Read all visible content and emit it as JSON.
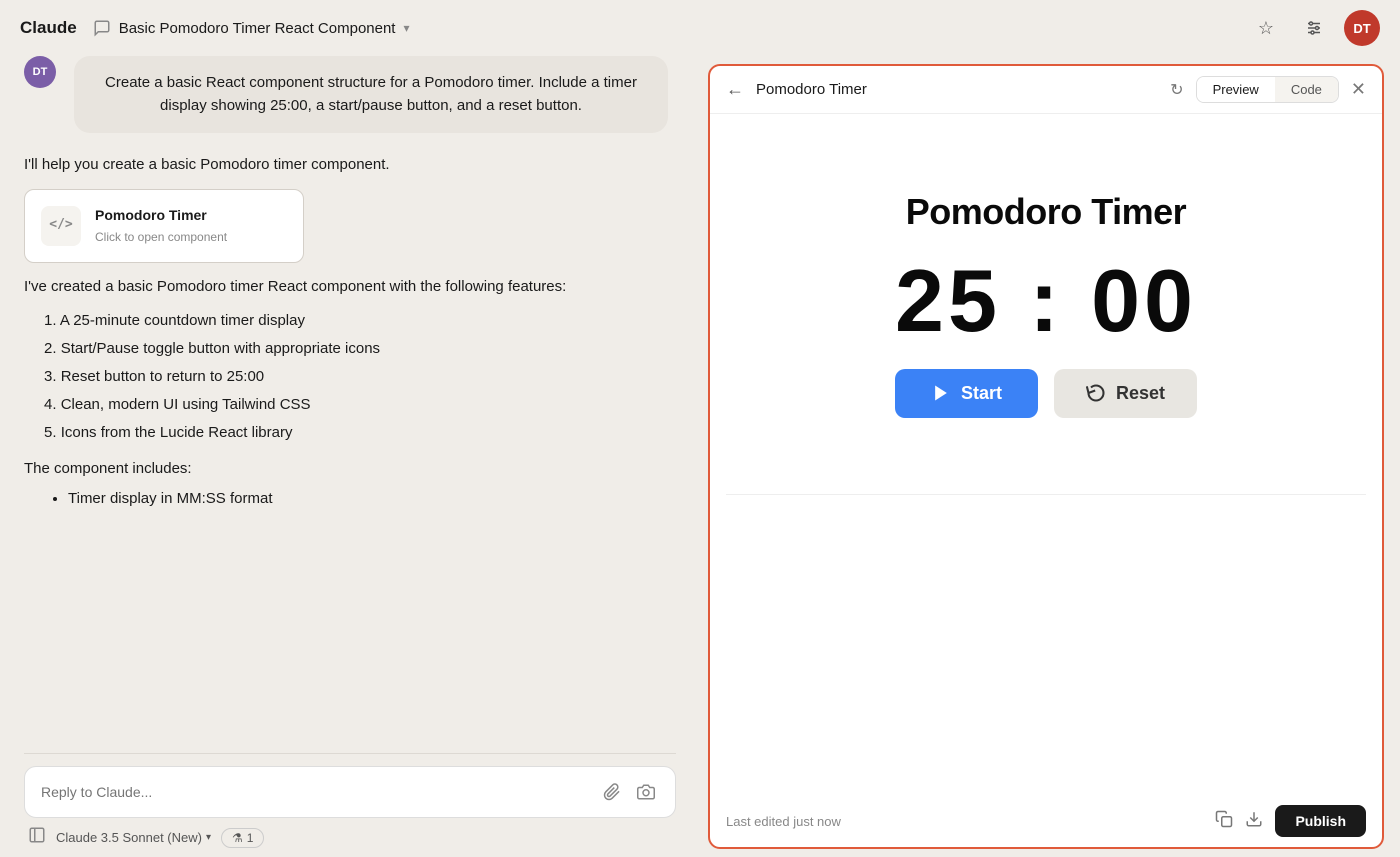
{
  "app": {
    "name": "Claude",
    "convo_title": "Basic Pomodoro Timer React Component",
    "convo_title_chevron": "▾"
  },
  "nav": {
    "star_icon": "☆",
    "settings_icon": "⚙",
    "avatar_initials": "DT"
  },
  "chat": {
    "user_avatar": "DT",
    "user_message": "Create a basic React component structure for a Pomodoro timer. Include a timer display showing 25:00, a start/pause button, and a reset button.",
    "assistant_intro": "I'll help you create a basic Pomodoro timer component.",
    "component_card": {
      "title": "Pomodoro Timer",
      "subtitle": "Click to open component",
      "icon": "</>"
    },
    "assistant_body1": "I've created a basic Pomodoro timer React component with the following features:",
    "features": [
      "A 25-minute countdown timer display",
      "Start/Pause toggle button with appropriate icons",
      "Reset button to return to 25:00",
      "Clean, modern UI using Tailwind CSS",
      "Icons from the Lucide React library"
    ],
    "component_includes_label": "The component includes:",
    "includes": [
      "Timer display in MM:SS format"
    ]
  },
  "input": {
    "placeholder": "Reply to Claude...",
    "model_name": "Claude 3.5 Sonnet (New)",
    "context_count": "1",
    "context_icon": "⚗"
  },
  "preview": {
    "back_icon": "←",
    "refresh_icon": "↻",
    "title": "Pomodoro Timer",
    "tabs": [
      {
        "label": "Preview",
        "active": true
      },
      {
        "label": "Code",
        "active": false
      }
    ],
    "close_icon": "✕",
    "pomodoro": {
      "title": "Pomodoro Timer",
      "time": "25 : 00",
      "start_label": "Start",
      "reset_label": "Reset"
    },
    "footer": {
      "last_edited": "Last edited just now",
      "copy_icon": "⧉",
      "download_icon": "↓",
      "publish_label": "Publish"
    }
  }
}
